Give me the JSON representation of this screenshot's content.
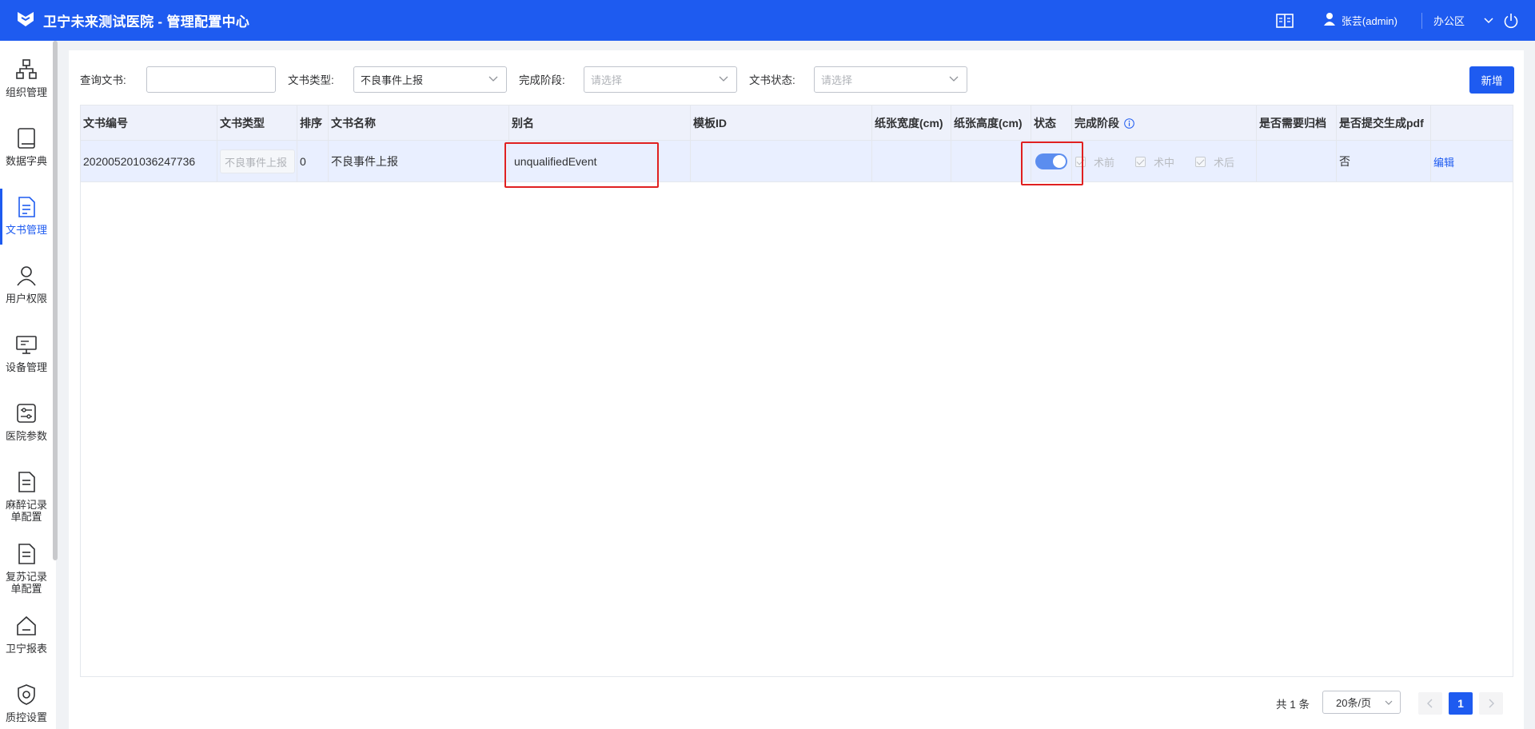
{
  "header": {
    "title": "卫宁未来测试医院 - 管理配置中心",
    "user": "张芸(admin)",
    "location": "办公区"
  },
  "sidebar": {
    "items": [
      {
        "label": "组织管理",
        "icon": "org-icon"
      },
      {
        "label": "数据字典",
        "icon": "book-icon"
      },
      {
        "label": "文书管理",
        "icon": "document-icon",
        "active": true
      },
      {
        "label": "用户权限",
        "icon": "user-icon"
      },
      {
        "label": "设备管理",
        "icon": "monitor-icon"
      },
      {
        "label": "医院参数",
        "icon": "settings-box-icon"
      },
      {
        "label": "麻醉记录单配置",
        "icon": "document-icon"
      },
      {
        "label": "复苏记录单配置",
        "icon": "document-icon"
      },
      {
        "label": "卫宁报表",
        "icon": "home-icon"
      },
      {
        "label": "质控设置",
        "icon": "shield-icon"
      }
    ]
  },
  "filters": {
    "query_label": "查询文书:",
    "query_value": "",
    "type_label": "文书类型:",
    "type_value": "不良事件上报",
    "stage_label": "完成阶段:",
    "stage_placeholder": "请选择",
    "status_label": "文书状态:",
    "status_placeholder": "请选择",
    "new_button": "新增"
  },
  "table": {
    "columns": [
      "文书编号",
      "文书类型",
      "排序",
      "文书名称",
      "别名",
      "模板ID",
      "纸张宽度(cm)",
      "纸张高度(cm)",
      "状态",
      "完成阶段",
      "是否需要归档",
      "是否提交生成pdf",
      ""
    ],
    "rows": [
      {
        "doc_id": "202005201036247736",
        "doc_type": "不良事件上报",
        "sort": "0",
        "doc_name": "不良事件上报",
        "alias": "unqualifiedEvent",
        "template_id": "",
        "paper_width": "",
        "paper_height": "",
        "status_on": true,
        "stages": [
          "术前",
          "术中",
          "术后"
        ],
        "need_archive": "",
        "submit_pdf": "否",
        "action": "编辑"
      }
    ]
  },
  "pagination": {
    "total": "共 1 条",
    "page_size": "20条/页",
    "current_page": "1"
  },
  "colors": {
    "primary": "#1e5bf0",
    "highlight": "#e02020",
    "row_selected": "#e9efff"
  }
}
